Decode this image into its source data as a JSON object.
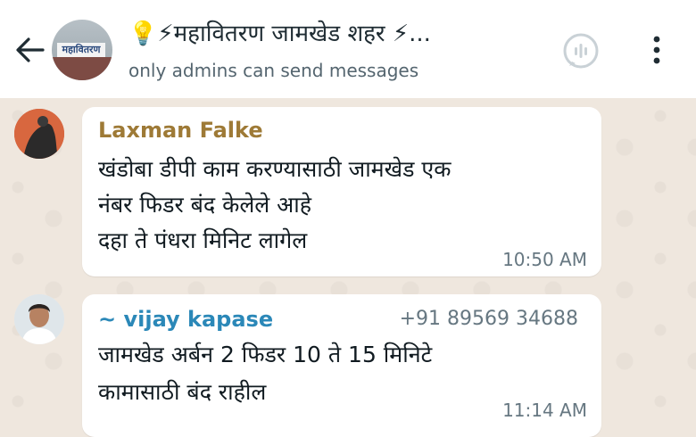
{
  "header": {
    "title": "💡⚡महावितरण जामखेड शहर ⚡...",
    "subtitle": "only admins can send messages",
    "avatar_sign_text": "महावितरण",
    "icons": [
      "back-arrow-icon",
      "audio-call-icon",
      "more-vert-icon"
    ]
  },
  "messages": [
    {
      "sender": "Laxman Falke",
      "sender_color": "#9e7a36",
      "phone": "",
      "lines": [
        "खंडोबा डीपी काम करण्यासाठी जामखेड एक",
        "नंबर फिडर बंद केलेले आहे",
        "दहा ते पंधरा मिनिट लागेल"
      ],
      "time": "10:50 AM"
    },
    {
      "sender": "~ vijay kapase",
      "sender_color": "#2b88b8",
      "phone": "+91 89569 34688",
      "lines": [
        "जामखेड अर्बन 2 फिडर 10 ते 15 मिनिटे",
        "कामासाठी बंद राहील"
      ],
      "time": "11:14 AM"
    }
  ],
  "colors": {
    "header_bg": "#ffffff",
    "chat_bg": "#efe7de",
    "bubble_bg": "#ffffff"
  }
}
